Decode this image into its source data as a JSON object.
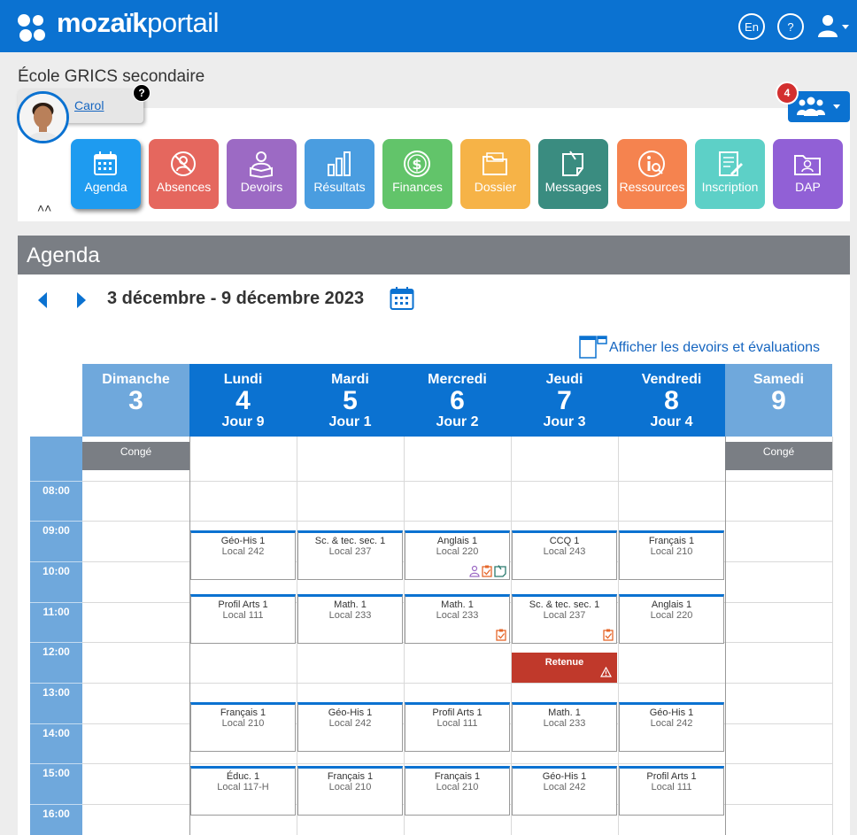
{
  "app": {
    "brand_bold": "mozaïk",
    "brand_light": "portail",
    "lang_label": "En",
    "help_label": "?"
  },
  "school": {
    "name": "École GRICS secondaire"
  },
  "student": {
    "name": "Carol",
    "help": "?"
  },
  "notifications": {
    "count": "4"
  },
  "modules": [
    {
      "label": "Agenda",
      "color": "#1e9bf0",
      "icon": "calendar-icon"
    },
    {
      "label": "Absences",
      "color": "#e5675e",
      "icon": "no-person-icon"
    },
    {
      "label": "Devoirs",
      "color": "#9c6ac4",
      "icon": "student-book-icon"
    },
    {
      "label": "Résultats",
      "color": "#4a9de0",
      "icon": "bar-chart-icon"
    },
    {
      "label": "Finances",
      "color": "#62c46a",
      "icon": "dollar-icon"
    },
    {
      "label": "Dossier",
      "color": "#f6b347",
      "icon": "folder-icon"
    },
    {
      "label": "Messages",
      "color": "#3a8c80",
      "icon": "note-icon"
    },
    {
      "label": "Ressources",
      "color": "#f5834f",
      "icon": "info-person-icon"
    },
    {
      "label": "Inscription",
      "color": "#5dd0c7",
      "icon": "edit-form-icon"
    },
    {
      "label": "DAP",
      "color": "#9160d6",
      "icon": "profile-folder-icon"
    }
  ],
  "agenda": {
    "title": "Agenda",
    "date_range": "3 décembre - 9 décembre 2023",
    "show_link": "Afficher les devoirs et évaluations",
    "days": [
      {
        "name": "Dimanche",
        "date": "3",
        "jour": "",
        "color": "#6fa8dc"
      },
      {
        "name": "Lundi",
        "date": "4",
        "jour": "Jour 9",
        "color": "#0b72d1"
      },
      {
        "name": "Mardi",
        "date": "5",
        "jour": "Jour 1",
        "color": "#0b72d1"
      },
      {
        "name": "Mercredi",
        "date": "6",
        "jour": "Jour 2",
        "color": "#0b72d1"
      },
      {
        "name": "Jeudi",
        "date": "7",
        "jour": "Jour 3",
        "color": "#0b72d1"
      },
      {
        "name": "Vendredi",
        "date": "8",
        "jour": "Jour 4",
        "color": "#0b72d1"
      },
      {
        "name": "Samedi",
        "date": "9",
        "jour": "",
        "color": "#6fa8dc"
      }
    ],
    "hours": [
      "08:00",
      "09:00",
      "10:00",
      "11:00",
      "12:00",
      "13:00",
      "14:00",
      "15:00",
      "16:00"
    ],
    "conge_label": "Congé",
    "retenue_label": "Retenue",
    "events": [
      {
        "day": 1,
        "slot": 0,
        "title": "Géo-His 1",
        "room": "Local 242"
      },
      {
        "day": 2,
        "slot": 0,
        "title": "Sc. & tec. sec. 1",
        "room": "Local 237"
      },
      {
        "day": 3,
        "slot": 0,
        "title": "Anglais 1",
        "room": "Local 220",
        "icons": [
          "homework-icon",
          "evaluation-icon",
          "note-icon"
        ]
      },
      {
        "day": 4,
        "slot": 0,
        "title": "CCQ 1",
        "room": "Local 243"
      },
      {
        "day": 5,
        "slot": 0,
        "title": "Français 1",
        "room": "Local 210"
      },
      {
        "day": 1,
        "slot": 1,
        "title": "Profil Arts 1",
        "room": "Local 111"
      },
      {
        "day": 2,
        "slot": 1,
        "title": "Math. 1",
        "room": "Local 233"
      },
      {
        "day": 3,
        "slot": 1,
        "title": "Math. 1",
        "room": "Local 233",
        "icons": [
          "evaluation-icon"
        ]
      },
      {
        "day": 4,
        "slot": 1,
        "title": "Sc. & tec. sec. 1",
        "room": "Local 237",
        "icons": [
          "evaluation-icon"
        ]
      },
      {
        "day": 5,
        "slot": 1,
        "title": "Anglais 1",
        "room": "Local 220"
      },
      {
        "day": 1,
        "slot": 2,
        "title": "Français 1",
        "room": "Local 210"
      },
      {
        "day": 2,
        "slot": 2,
        "title": "Géo-His 1",
        "room": "Local 242"
      },
      {
        "day": 3,
        "slot": 2,
        "title": "Profil Arts 1",
        "room": "Local 111"
      },
      {
        "day": 4,
        "slot": 2,
        "title": "Math. 1",
        "room": "Local 233"
      },
      {
        "day": 5,
        "slot": 2,
        "title": "Géo-His 1",
        "room": "Local 242"
      },
      {
        "day": 1,
        "slot": 3,
        "title": "Éduc. 1",
        "room": "Local 117-H"
      },
      {
        "day": 2,
        "slot": 3,
        "title": "Français 1",
        "room": "Local 210"
      },
      {
        "day": 3,
        "slot": 3,
        "title": "Français 1",
        "room": "Local 210"
      },
      {
        "day": 4,
        "slot": 3,
        "title": "Géo-His 1",
        "room": "Local 242"
      },
      {
        "day": 5,
        "slot": 3,
        "title": "Profil Arts 1",
        "room": "Local 111"
      }
    ]
  }
}
